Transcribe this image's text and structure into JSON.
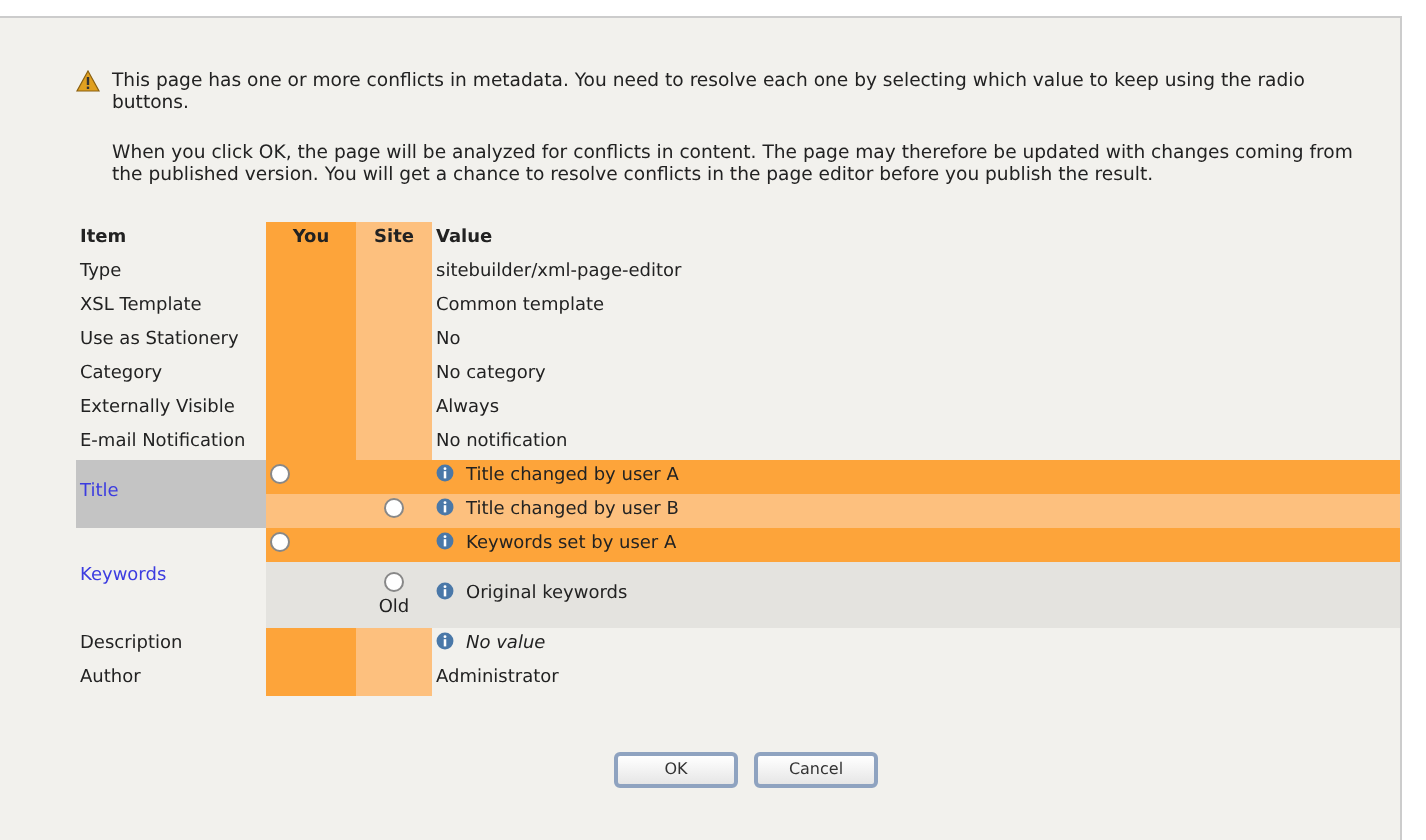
{
  "notice": {
    "paragraphs": [
      "This page has one or more conflicts in metadata. You need to resolve each one by selecting which value to keep using the radio buttons.",
      "When you click OK, the page will be analyzed for conflicts in content. The page may therefore be updated with changes coming from the published version. You will get a chance to resolve conflicts in the page editor before you publish the result."
    ]
  },
  "table": {
    "columns": [
      "Item",
      "You",
      "Site",
      "Value"
    ],
    "rows": [
      {
        "kind": "plain",
        "item": "Type",
        "value": "sitebuilder/xml-page-editor"
      },
      {
        "kind": "plain",
        "item": "XSL Template",
        "value": "Common template"
      },
      {
        "kind": "plain",
        "item": "Use as Stationery",
        "value": "No"
      },
      {
        "kind": "plain",
        "item": "Category",
        "value": "No category"
      },
      {
        "kind": "plain",
        "item": "Externally Visible",
        "value": "Always"
      },
      {
        "kind": "plain",
        "item": "E-mail Notification",
        "value": "No notification"
      },
      {
        "kind": "conflict",
        "item": "Title",
        "highlighted": true,
        "options": [
          {
            "kind": "you",
            "label": "Title changed by user A",
            "selected": false
          },
          {
            "kind": "site",
            "label": "Title changed by user B",
            "selected": false
          }
        ]
      },
      {
        "kind": "conflict",
        "item": "Keywords",
        "highlighted": false,
        "options": [
          {
            "kind": "you",
            "label": "Keywords set by user A",
            "selected": false
          },
          {
            "kind": "old",
            "label": "Original keywords",
            "selected": false,
            "caption": "Old"
          }
        ]
      },
      {
        "kind": "plain",
        "item": "Description",
        "value": "No value",
        "info": true,
        "missing": true
      },
      {
        "kind": "plain",
        "item": "Author",
        "value": "Administrator"
      }
    ]
  },
  "buttons": [
    "OK",
    "Cancel"
  ]
}
